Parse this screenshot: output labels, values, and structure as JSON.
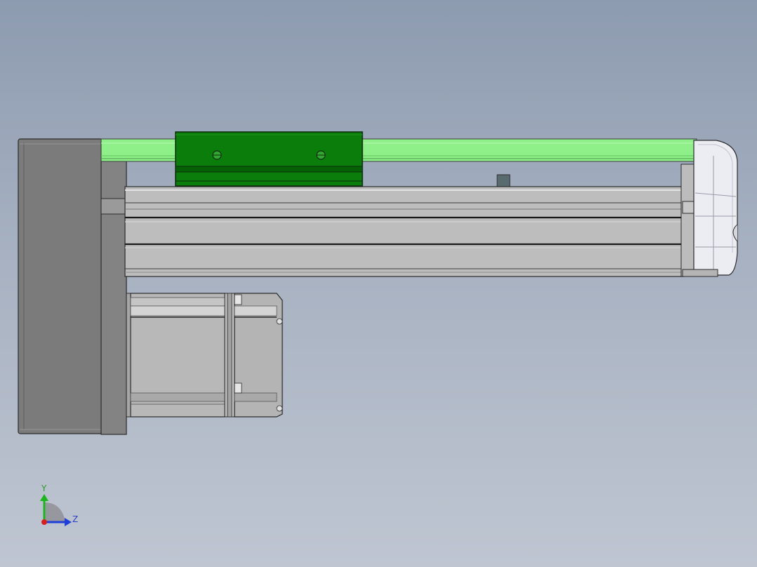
{
  "viewport": {
    "background_top": "#8d9bb0",
    "background_bottom": "#bfc6d2"
  },
  "model": {
    "rail_color": "#8ff08a",
    "carriage_color": "#0a7d0a",
    "body_color": "#bdbdbd",
    "end_plate_color": "#7b7b7b",
    "motor_color": "#b8b8b8"
  },
  "triad": {
    "y_label": "Y",
    "z_label": "Z",
    "y_color": "#1db51d",
    "z_color": "#1f3fd8",
    "x_color": "#d81f1f"
  }
}
